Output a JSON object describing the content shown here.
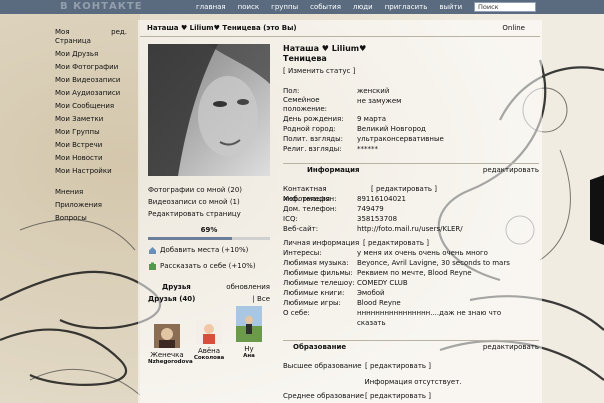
{
  "topbar": {
    "logo": "В КОНТАКТЕ",
    "nav": [
      "главная",
      "поиск",
      "группы",
      "события",
      "люди",
      "пригласить",
      "выйти"
    ],
    "search_value": "Поиск"
  },
  "menu": {
    "first_left": "Моя Страница",
    "first_right": "ред.",
    "items": [
      "Мои Друзья",
      "Мои Фотографии",
      "Мои Видеозаписи",
      "Мои Аудиозаписи",
      "Мои Сообщения",
      "Мои Заметки",
      "Мои Группы",
      "Мои Встречи",
      "Мои Новости",
      "Мои Настройки"
    ],
    "extra": [
      "Мнения",
      "Приложения",
      "Вопросы"
    ]
  },
  "header": {
    "status_line": "Наташа ♥ Lilium♥ Теницева (это Вы)",
    "online": "Online"
  },
  "left": {
    "actions": [
      "Фотографии со мной (20)",
      "Видеозаписи со мной (1)",
      "Редактировать страницу"
    ],
    "percent": "69%",
    "percent_value": 0.69,
    "add_place": "Добавить места (+10%)",
    "tell_school": "Рассказать о себе (+10%)",
    "friends_title": "Друзья",
    "friends_updates": "обновления",
    "friends_count": "Друзья (40)",
    "friends_all": "| Все",
    "friends": [
      {
        "name": "Женечка",
        "sub": "Nzhegorodova"
      },
      {
        "name": "Авёна",
        "sub": "Соколова"
      },
      {
        "name": "Ну",
        "sub": "Ана"
      }
    ]
  },
  "profile": {
    "name_line1": "Наташа ♥ Lilium♥",
    "name_line2": "Теницева",
    "change_status": "[ Изменить статус ]",
    "basic": [
      {
        "k": "Пол:",
        "v": "женский"
      },
      {
        "k": "Семейное положение:",
        "v": "не замужем"
      },
      {
        "k": "День рождения:",
        "v": "9 марта"
      },
      {
        "k": "Родной город:",
        "v": "Великий Новгород"
      },
      {
        "k": "Полит. взгляды:",
        "v": "ультраконсервативные"
      },
      {
        "k": "Религ. взгляды:",
        "v": "******"
      }
    ],
    "info_title": "Информация",
    "edit": "редактировать",
    "contact_title": "Контактная информация",
    "contact_edit": "[ редактировать ]",
    "contacts": [
      {
        "k": "Моб. телефон:",
        "v": "89116104021"
      },
      {
        "k": "Дом. телефон:",
        "v": "749479"
      },
      {
        "k": "ICQ:",
        "v": "358153708"
      },
      {
        "k": "Веб-сайт:",
        "v": "http://foto.mail.ru/users/KLER/"
      }
    ],
    "personal_title": "Личная информация",
    "personal_edit": "[ редактировать ]",
    "personal": [
      {
        "k": "Интересы:",
        "v": "у меня их очень очень очень много"
      },
      {
        "k": "Любимая музыка:",
        "v": "Beyonce, Avril Lavigne, 30 seconds to mars"
      },
      {
        "k": "Любимые фильмы:",
        "v": "Реквием по мечте, Blood Reyne"
      },
      {
        "k": "Любимые телешоу:",
        "v": "COMEDY CLUB"
      },
      {
        "k": "Любимые книги:",
        "v": "Эмобой"
      },
      {
        "k": "Любимые игры:",
        "v": "Blood Reyne"
      },
      {
        "k": "О себе:",
        "v": "нннннннннннннннн....даж не знаю что"
      },
      {
        "k": "",
        "v": "сказать"
      }
    ],
    "edu_title": "Образование",
    "higher": "Высшее образование",
    "higher_edit": "[ редактировать ]",
    "no_info": "Информация отсутствует.",
    "secondary": "Среднее образование",
    "secondary_edit": "[ редактировать ]"
  }
}
